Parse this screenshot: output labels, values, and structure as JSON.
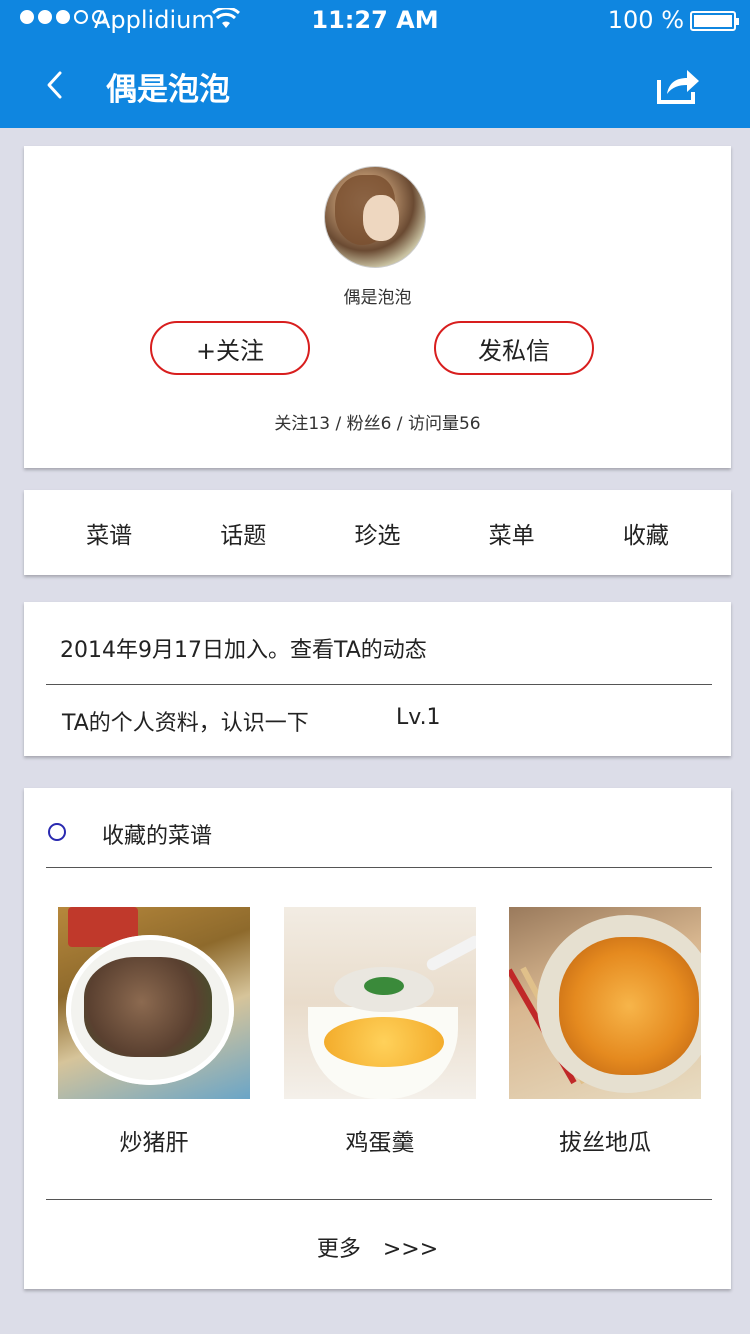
{
  "status_bar": {
    "carrier": "Applidium",
    "time": "11:27 AM",
    "battery": "100 %"
  },
  "nav": {
    "title": "偶是泡泡",
    "back_icon": "chevron-left-icon",
    "share_icon": "share-icon"
  },
  "profile": {
    "name": "偶是泡泡",
    "follow_label": "+关注",
    "message_label": "发私信",
    "stats": "关注13 / 粉丝6 / 访问量56"
  },
  "tabs": [
    {
      "label": "菜谱"
    },
    {
      "label": "话题"
    },
    {
      "label": "珍选"
    },
    {
      "label": "菜单"
    },
    {
      "label": "收藏"
    }
  ],
  "info": {
    "joined": "2014年9月17日加入。查看TA的动态",
    "profile_link": "TA的个人资料，认识一下",
    "level": "Lv.1"
  },
  "favorites": {
    "title": "收藏的菜谱",
    "recipes": [
      {
        "name": "炒猪肝"
      },
      {
        "name": "鸡蛋羹"
      },
      {
        "name": "拔丝地瓜"
      }
    ],
    "more_label": "更多",
    "more_arrows": ">>>"
  },
  "colors": {
    "nav_bg": "#0f86e0",
    "accent_red": "#d81e1e",
    "page_bg": "#dcdde8"
  }
}
